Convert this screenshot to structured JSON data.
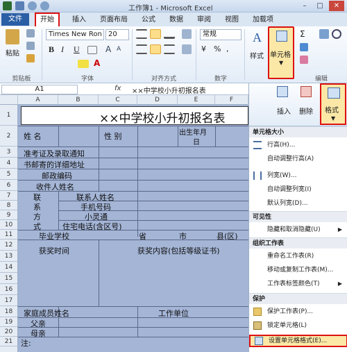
{
  "window": {
    "title": "工作簿1 - Microsoft Excel"
  },
  "tabs": [
    "文件",
    "开始",
    "插入",
    "页面布局",
    "公式",
    "数据",
    "审阅",
    "视图",
    "加载项"
  ],
  "ribbon": {
    "clipboard": {
      "paste": "粘贴",
      "label": "剪贴板"
    },
    "font": {
      "name": "Times New Ron",
      "size": "20",
      "bold": "B",
      "italic": "I",
      "underline": "U",
      "font_color_letter": "A",
      "grow": "A",
      "shrink": "A",
      "label": "字体"
    },
    "alignment": {
      "label": "对齐方式"
    },
    "number": {
      "format": "常规",
      "currency": "¥",
      "percent": "%",
      "comma": ",",
      "label": "数字"
    },
    "styles": {
      "btn": "样式",
      "letter": "A"
    },
    "cells": {
      "btn": "单元格"
    },
    "editing": {
      "sum": "Σ",
      "label": "编辑"
    }
  },
  "formula_bar": {
    "name_box": "A1",
    "fx": "fx",
    "value": "××中学校小升初报名表"
  },
  "columns": [
    "A",
    "B",
    "C",
    "D",
    "E",
    "F"
  ],
  "rows": [
    "1",
    "2",
    "3",
    "4",
    "5",
    "6",
    "7",
    "8",
    "9",
    "10",
    "11",
    "12",
    "13",
    "14",
    "15",
    "16",
    "17",
    "18",
    "19",
    "20",
    "21"
  ],
  "sheet": {
    "title": "××中学校小升初报名表",
    "name": "姓 名",
    "gender": "性 别",
    "birth_1": "出生年月",
    "birth_2": "日",
    "notice_1": "准考证及录取通知",
    "notice_2": "书邮寄的详细地址",
    "postcode": "邮政编码",
    "recipient": "收件人姓名",
    "contact_1": "联",
    "contact_2": "系",
    "contact_3": "方",
    "contact_4": "式",
    "contact_name": "联系人姓名",
    "mobile": "手机号码",
    "xiaolingtong": "小灵通",
    "home_phone": "住宅电话(含区号)",
    "school": "毕业学校",
    "province": "省",
    "city": "市",
    "county": "县(区)",
    "award_time": "获奖时间",
    "award_content": "获奖内容(包括等级证书)",
    "family": "家庭成员姓名",
    "work": "工作单位",
    "father": "父亲",
    "mother": "母亲",
    "note": "注:"
  },
  "cells_group": {
    "insert": "插入",
    "delete": "删除",
    "format": "格式"
  },
  "menu": {
    "size_head": "单元格大小",
    "row_height": "行高(H)...",
    "auto_row": "自动调整行高(A)",
    "col_width": "列宽(W)...",
    "auto_col": "自动调整列宽(I)",
    "default_width": "默认列宽(D)...",
    "visibility_head": "可见性",
    "hide_unhide": "隐藏和取消隐藏(U)",
    "organize_head": "组织工作表",
    "rename": "重命名工作表(R)",
    "move_copy": "移动或复制工作表(M)...",
    "tab_color": "工作表标签颜色(T)",
    "protect_head": "保护",
    "protect_sheet": "保护工作表(P)...",
    "lock_cell": "锁定单元格(L)",
    "format_cells": "设置单元格格式(E)..."
  }
}
